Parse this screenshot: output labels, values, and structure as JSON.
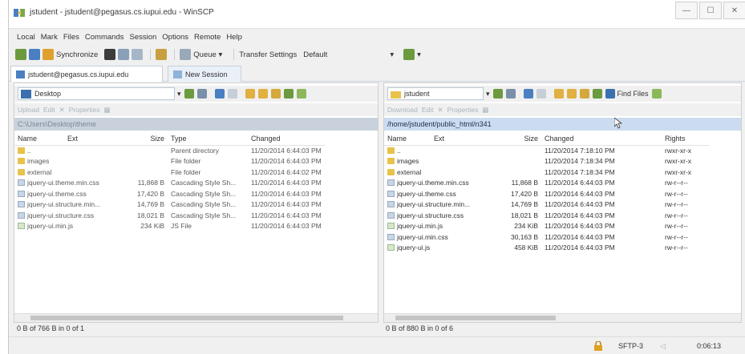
{
  "window": {
    "title": "jstudent - jstudent@pegasus.cs.iupui.edu - WinSCP",
    "controls": [
      "—",
      "☐",
      "✕"
    ]
  },
  "menu": [
    "Local",
    "Mark",
    "Files",
    "Commands",
    "Session",
    "Options",
    "Remote",
    "Help"
  ],
  "toolbar": {
    "synchronize": "Synchronize",
    "queue": "Queue",
    "transfer_settings": "Transfer Settings",
    "transfer_value": "Default"
  },
  "session_tabs": {
    "active": "jstudent@pegasus.cs.iupui.edu",
    "new": "New Session"
  },
  "left_panel": {
    "location": "Desktop",
    "actions": [
      "Upload",
      "Edit",
      "Properties"
    ],
    "path": "C:\\Users\\Desktop\\theme",
    "columns": [
      "Name",
      "Ext",
      "Size",
      "Type",
      "Changed"
    ],
    "rows": [
      {
        "icon": "up",
        "name": "..",
        "size": "",
        "type": "Parent directory",
        "changed": "11/20/2014 6:44:03 PM"
      },
      {
        "icon": "folder",
        "name": "images",
        "size": "",
        "type": "File folder",
        "changed": "11/20/2014 6:44:03 PM"
      },
      {
        "icon": "folder",
        "name": "external",
        "size": "",
        "type": "File folder",
        "changed": "11/20/2014 6:44:02 PM"
      },
      {
        "icon": "css",
        "name": "jquery-ui.theme.min.css",
        "size": "11,868 B",
        "type": "Cascading Style Sh...",
        "changed": "11/20/2014 6:44:03 PM"
      },
      {
        "icon": "css",
        "name": "jquery-ui.theme.css",
        "size": "17,420 B",
        "type": "Cascading Style Sh...",
        "changed": "11/20/2014 6:44:03 PM"
      },
      {
        "icon": "css",
        "name": "jquery-ui.structure.min...",
        "size": "14,769 B",
        "type": "Cascading Style Sh...",
        "changed": "11/20/2014 6:44:03 PM"
      },
      {
        "icon": "css",
        "name": "jquery-ui.structure.css",
        "size": "18,021 B",
        "type": "Cascading Style Sh...",
        "changed": "11/20/2014 6:44:03 PM"
      },
      {
        "icon": "js",
        "name": "jquery-ui.min.js",
        "size": "234 KiB",
        "type": "JS File",
        "changed": "11/20/2014 6:44:03 PM"
      }
    ],
    "status": "0 B of 766 B in 0 of 1"
  },
  "right_panel": {
    "location": "jstudent",
    "find_files": "Find Files",
    "actions": [
      "Download",
      "Edit",
      "Properties"
    ],
    "path": "/home/jstudent/public_html/n341",
    "columns": [
      "Name",
      "Ext",
      "Size",
      "Changed",
      "Rights"
    ],
    "rows": [
      {
        "icon": "up",
        "name": "..",
        "size": "",
        "changed": "11/20/2014 7:18:10 PM",
        "rights": "rwxr-xr-x"
      },
      {
        "icon": "folder",
        "name": "images",
        "size": "",
        "changed": "11/20/2014 7:18:34 PM",
        "rights": "rwxr-xr-x"
      },
      {
        "icon": "folder",
        "name": "external",
        "size": "",
        "changed": "11/20/2014 7:18:34 PM",
        "rights": "rwxr-xr-x"
      },
      {
        "icon": "css",
        "name": "jquery-ui.theme.min.css",
        "size": "11,868 B",
        "changed": "11/20/2014 6:44:03 PM",
        "rights": "rw-r--r--"
      },
      {
        "icon": "css",
        "name": "jquery-ui.theme.css",
        "size": "17,420 B",
        "changed": "11/20/2014 6:44:03 PM",
        "rights": "rw-r--r--"
      },
      {
        "icon": "css",
        "name": "jquery-ui.structure.min...",
        "size": "14,769 B",
        "changed": "11/20/2014 6:44:03 PM",
        "rights": "rw-r--r--"
      },
      {
        "icon": "css",
        "name": "jquery-ui.structure.css",
        "size": "18,021 B",
        "changed": "11/20/2014 6:44:03 PM",
        "rights": "rw-r--r--"
      },
      {
        "icon": "js",
        "name": "jquery-ui.min.js",
        "size": "234 KiB",
        "changed": "11/20/2014 6:44:03 PM",
        "rights": "rw-r--r--"
      },
      {
        "icon": "css",
        "name": "jquery-ui.min.css",
        "size": "30,163 B",
        "changed": "11/20/2014 6:44:03 PM",
        "rights": "rw-r--r--"
      },
      {
        "icon": "js",
        "name": "jquery-ui.js",
        "size": "458 KiB",
        "changed": "11/20/2014 6:44:03 PM",
        "rights": "rw-r--r--"
      }
    ],
    "status": "0 B of 880 B in 0 of 6"
  },
  "statusbar": {
    "protocol": "SFTP-3",
    "elapsed": "0:06:13"
  }
}
